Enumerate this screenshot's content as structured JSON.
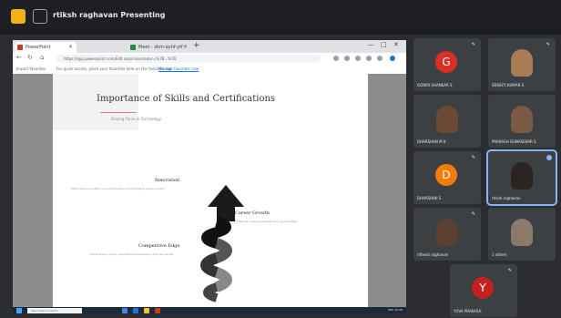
{
  "window": {
    "title": "rtiksh raghavan Presenting"
  },
  "browser": {
    "tabs": [
      {
        "label": "PowerPoint",
        "color": "#c43e1c",
        "active": true
      },
      {
        "label": "Meet - zkm-qvhf-ytf",
        "color": "#1e8e3e",
        "active": false
      }
    ],
    "new_tab": "+",
    "window_controls": [
      "—",
      "□",
      "✕"
    ],
    "url": "https://app.powerpoint.com/Edit.aspx?sourcedoc=%7B...%7D",
    "bookmarks": {
      "import": "Import favorites",
      "hint": "For quick access, place your favorites here on the favorites bar.",
      "link": "Manage favorites now"
    }
  },
  "slide": {
    "title": "Importance of Skills and Certifications",
    "subtitle": "Driving Force in Technology",
    "items": [
      {
        "heading": "Innovation",
        "desc": "Skills drive innovation and contribute to technological advancement"
      },
      {
        "heading": "Career Growth",
        "desc": "Enhances career prospects and opportunities"
      },
      {
        "heading": "Competitive Edge",
        "desc": "Certifications give a competitive advantage in the job market"
      }
    ]
  },
  "taskbar": {
    "search": "Type here to search",
    "tray": "ENG 10:38"
  },
  "participants": [
    {
      "name": "GOWRI SHANKAR S",
      "initial": "G",
      "color": "#d93025",
      "type": "initial",
      "mic": true
    },
    {
      "name": "SRISHTI KUMAR S",
      "type": "photo",
      "mic": true
    },
    {
      "name": "DHARSHAN M K",
      "type": "photo",
      "mic": false
    },
    {
      "name": "PRAKASH GUNASEKAR S",
      "type": "photo",
      "mic": false
    },
    {
      "name": "DHARSHINI S",
      "initial": "D",
      "color": "#f57c00",
      "type": "initial",
      "mic": true
    },
    {
      "name": "rtiksh raghavan",
      "type": "photo",
      "mic": false,
      "speaking": true
    },
    {
      "name": "rithesh raghavan",
      "type": "photo",
      "mic": true
    },
    {
      "name": "1 others",
      "type": "photo",
      "mic": false
    },
    {
      "name": "YUVA PRAKASH",
      "initial": "Y",
      "color": "#c5221f",
      "type": "initial",
      "mic": true
    }
  ],
  "colors": {
    "accent": "#8ab4f8",
    "tile": "#3c4043",
    "background": "#2b2d31"
  }
}
